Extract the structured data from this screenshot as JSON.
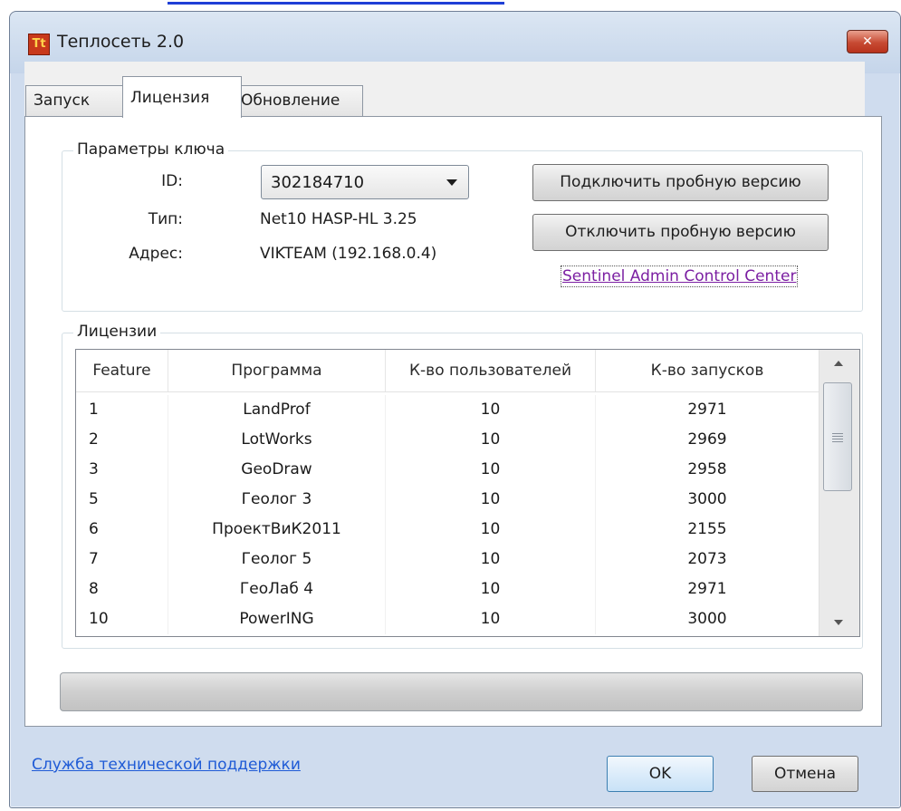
{
  "window": {
    "title": "Теплосеть 2.0",
    "icon_text": "Tt",
    "close_glyph": "✕"
  },
  "tabs": [
    {
      "label": "Запуск"
    },
    {
      "label": "Лицензия"
    },
    {
      "label": "Обновление"
    }
  ],
  "key_params": {
    "legend": "Параметры ключа",
    "id_label": "ID:",
    "id_value": "302184710",
    "type_label": "Тип:",
    "type_value": "Net10 HASP-HL 3.25",
    "address_label": "Адрес:",
    "address_value": "VIKTEAM (192.168.0.4)",
    "connect_trial_button": "Подключить пробную версию",
    "disconnect_trial_button": "Отключить пробную версию",
    "sentinel_link": "Sentinel Admin Control Center"
  },
  "licenses": {
    "legend": "Лицензии",
    "columns": [
      "Feature",
      "Программа",
      "К-во пользователей",
      "К-во запусков"
    ],
    "rows": [
      [
        "1",
        "LandProf",
        "10",
        "2971"
      ],
      [
        "2",
        "LotWorks",
        "10",
        "2969"
      ],
      [
        "3",
        "GeoDraw",
        "10",
        "2958"
      ],
      [
        "5",
        "Геолог 3",
        "10",
        "3000"
      ],
      [
        "6",
        "ПроектВиК2011",
        "10",
        "2155"
      ],
      [
        "7",
        "Геолог 5",
        "10",
        "2073"
      ],
      [
        "8",
        "ГеоЛаб 4",
        "10",
        "2971"
      ],
      [
        "10",
        "PowerING",
        "10",
        "3000"
      ]
    ]
  },
  "footer": {
    "support_link": "Служба технической поддержки",
    "ok_button": "OK",
    "cancel_button": "Отмена"
  },
  "colors": {
    "link": "#1f5bd6",
    "visited_link": "#7b1fa2",
    "title_bar": "#c5d5ea",
    "close_button": "#c74a33"
  }
}
